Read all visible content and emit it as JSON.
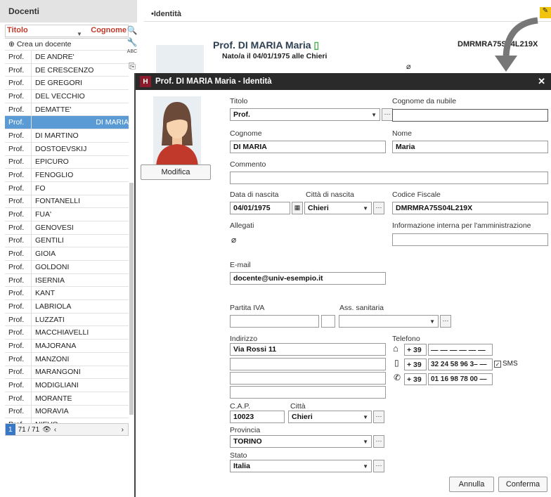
{
  "list": {
    "title": "Docenti",
    "col_titolo": "Titolo",
    "col_cognome": "Cognome",
    "create": "Crea un docente",
    "rows": [
      [
        "Prof.",
        "DE ANDRE'"
      ],
      [
        "Prof.",
        "DE CRESCENZO"
      ],
      [
        "Prof.",
        "DE GREGORI"
      ],
      [
        "Prof.",
        "DEL VECCHIO"
      ],
      [
        "Prof.",
        "DEMATTE'"
      ],
      [
        "Prof.",
        "DI MARIA"
      ],
      [
        "Prof.",
        "DI MARTINO"
      ],
      [
        "Prof.",
        "DOSTOEVSKIJ"
      ],
      [
        "Prof.",
        "EPICURO"
      ],
      [
        "Prof.",
        "FENOGLIO"
      ],
      [
        "Prof.",
        "FO"
      ],
      [
        "Prof.",
        "FONTANELLI"
      ],
      [
        "Prof.",
        "FUA'"
      ],
      [
        "Prof.",
        "GENOVESI"
      ],
      [
        "Prof.",
        "GENTILI"
      ],
      [
        "Prof.",
        "GIOIA"
      ],
      [
        "Prof.",
        "GOLDONI"
      ],
      [
        "Prof.",
        "ISERNIA"
      ],
      [
        "Prof.",
        "KANT"
      ],
      [
        "Prof.",
        "LABRIOLA"
      ],
      [
        "Prof.",
        "LUZZATI"
      ],
      [
        "Prof.",
        "MACCHIAVELLI"
      ],
      [
        "Prof.",
        "MAJORANA"
      ],
      [
        "Prof.",
        "MANZONI"
      ],
      [
        "Prof.",
        "MARANGONI"
      ],
      [
        "Prof.",
        "MODIGLIANI"
      ],
      [
        "Prof.",
        "MORANTE"
      ],
      [
        "Prof.",
        "MORAVIA"
      ],
      [
        "Prof.",
        "NIEVO"
      ]
    ],
    "selected_index": 5,
    "page": "1",
    "count": "71 / 71"
  },
  "background": {
    "section": "Identità",
    "name": "Prof. DI MARIA Maria",
    "born": "Nato/a il 04/01/1975 alle Chieri",
    "cf": "DMRMRA75S04L219X"
  },
  "dialog": {
    "title": "Prof. DI MARIA Maria - Identità",
    "modify": "Modifica",
    "titolo_label": "Titolo",
    "titolo": "Prof.",
    "cognome_nubile_label": "Cognome da nubile",
    "cognome_nubile": "",
    "cognome_label": "Cognome",
    "cognome": "DI MARIA",
    "nome_label": "Nome",
    "nome": "Maria",
    "commento_label": "Commento",
    "commento": "",
    "data_label": "Data di nascita",
    "data": "04/01/1975",
    "citta_nascita_label": "Città di nascita",
    "citta_nascita": "Chieri",
    "cf_label": "Codice Fiscale",
    "cf": "DMRMRA75S04L219X",
    "allegati_label": "Allegati",
    "info_label": "Informazione interna per l'amministrazione",
    "info": "",
    "email_label": "E-mail",
    "email": "docente@univ-esempio.it",
    "piva_label": "Partita IVA",
    "ass_label": "Ass. sanitaria",
    "indirizzo_label": "Indirizzo",
    "indirizzo": "Via Rossi 11",
    "telefono_label": "Telefono",
    "phones": [
      {
        "prefix": "+ 39",
        "number": "— — — — — —"
      },
      {
        "prefix": "+ 39",
        "number": "32 24 58 96 3– —"
      },
      {
        "prefix": "+ 39",
        "number": "01 16 98 78 00 —"
      }
    ],
    "sms": "SMS",
    "cap_label": "C.A.P.",
    "cap": "10023",
    "citta_label": "Città",
    "citta": "Chieri",
    "provincia_label": "Provincia",
    "provincia": "TORINO",
    "stato_label": "Stato",
    "stato": "Italia",
    "cancel": "Annulla",
    "confirm": "Conferma"
  }
}
